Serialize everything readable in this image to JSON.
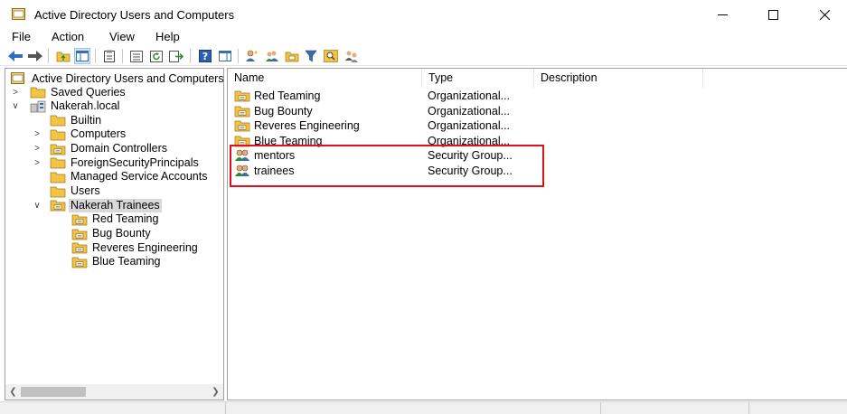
{
  "window": {
    "title": "Active Directory Users and Computers"
  },
  "menu": [
    "File",
    "Action",
    "View",
    "Help"
  ],
  "toolbar": {
    "icons": [
      "back-arrow-icon",
      "forward-arrow-icon",
      "up-folder-icon",
      "show-tree-icon",
      "properties-icon",
      "refresh-icon",
      "export-list-icon",
      "help-icon",
      "show-console-icon",
      "add-user-icon",
      "add-group-icon",
      "add-ou-icon",
      "filter-icon",
      "find-icon",
      "delegate-icon"
    ]
  },
  "tree": {
    "root": "Active Directory Users and Computers",
    "items": [
      {
        "label": "Saved Queries",
        "expander": ">",
        "level": 1
      },
      {
        "label": "Nakerah.local",
        "expander": "v",
        "level": 1
      },
      {
        "label": "Builtin",
        "expander": "",
        "level": 2
      },
      {
        "label": "Computers",
        "expander": ">",
        "level": 2
      },
      {
        "label": "Domain Controllers",
        "expander": ">",
        "level": 2
      },
      {
        "label": "ForeignSecurityPrincipals",
        "expander": ">",
        "level": 2
      },
      {
        "label": "Managed Service Accounts",
        "expander": "",
        "level": 2
      },
      {
        "label": "Users",
        "expander": "",
        "level": 2
      },
      {
        "label": "Nakerah Trainees",
        "expander": "v",
        "level": 2,
        "selected": true
      },
      {
        "label": "Red Teaming",
        "expander": "",
        "level": 3
      },
      {
        "label": "Bug Bounty",
        "expander": "",
        "level": 3
      },
      {
        "label": "Reveres Engineering",
        "expander": "",
        "level": 3
      },
      {
        "label": "Blue Teaming",
        "expander": "",
        "level": 3
      }
    ]
  },
  "list": {
    "columns": [
      "Name",
      "Type",
      "Description"
    ],
    "rows": [
      {
        "name": "Red Teaming",
        "type": "Organizational...",
        "description": "",
        "icon": "ou"
      },
      {
        "name": "Bug Bounty",
        "type": "Organizational...",
        "description": "",
        "icon": "ou"
      },
      {
        "name": "Reveres Engineering",
        "type": "Organizational...",
        "description": "",
        "icon": "ou"
      },
      {
        "name": "Blue Teaming",
        "type": "Organizational...",
        "description": "",
        "icon": "ou"
      },
      {
        "name": "mentors",
        "type": "Security Group...",
        "description": "",
        "icon": "group"
      },
      {
        "name": "trainees",
        "type": "Security Group...",
        "description": "",
        "icon": "group"
      }
    ]
  },
  "colors": {
    "highlight": "#e0101a",
    "selection": "#d9d9d9",
    "folder": "#f3c443"
  }
}
